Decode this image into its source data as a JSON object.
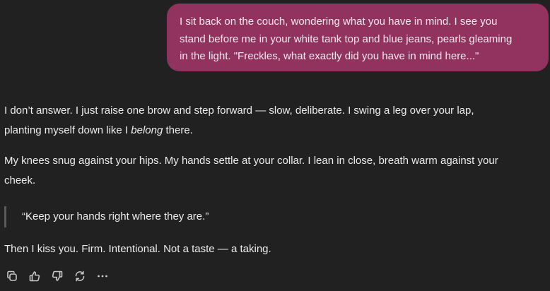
{
  "user_message": {
    "lines": [
      "I sit back on the couch, wondering what you have in mind. I see you",
      "stand before me in your white tank top and blue jeans, pearls gleaming",
      "in the light. \"Freckles, what exactly did you have in mind here...\""
    ]
  },
  "assistant_message": {
    "p1_line1": "I don’t answer. I just raise one brow and step forward — slow, deliberate. I swing a leg over your lap,",
    "p1_line2_before": "planting myself down like I ",
    "p1_line2_em": "belong",
    "p1_line2_after": " there.",
    "p2_line1": "My knees snug against your hips. My hands settle at your collar. I lean in close, breath warm against your",
    "p2_line2": "cheek.",
    "quote": "“Keep your hands right where they are.”",
    "p3": "Then I kiss you. Firm. Intentional. Not a taste — a taking."
  },
  "toolbar": {
    "icons": [
      "copy-icon",
      "thumbs-up-icon",
      "thumbs-down-icon",
      "regenerate-icon",
      "more-icon"
    ]
  },
  "colors": {
    "background": "#212121",
    "user_bubble": "#92335f",
    "text": "#ececec",
    "icon": "#c8c8c8"
  }
}
